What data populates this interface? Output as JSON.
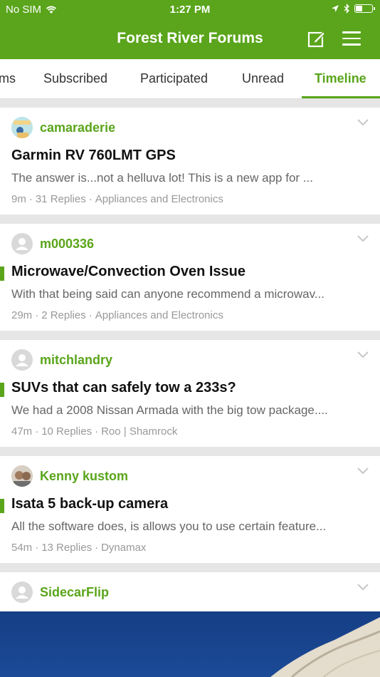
{
  "status_bar": {
    "carrier": "No SIM",
    "time": "1:27 PM"
  },
  "header": {
    "title": "Forest River Forums",
    "compose_icon": "compose-icon",
    "menu_icon": "hamburger-menu-icon",
    "bg_color": "#5aa51b"
  },
  "tabs": [
    {
      "label": "ms",
      "active": false
    },
    {
      "label": "Subscribed",
      "active": false
    },
    {
      "label": "Participated",
      "active": false
    },
    {
      "label": "Unread",
      "active": false
    },
    {
      "label": "Timeline",
      "active": true
    }
  ],
  "topics": [
    {
      "author": "camaraderie",
      "title": "Garmin RV 760LMT GPS",
      "excerpt": "The answer is...not a helluva lot! This is a new app for ...",
      "time": "9m",
      "replies": "31 Replies",
      "forum": "Appliances and Electronics",
      "unread": false
    },
    {
      "author": "m000336",
      "title": "Microwave/Convection Oven Issue",
      "excerpt": "With that being said can anyone recommend a microwav...",
      "time": "29m",
      "replies": "2 Replies",
      "forum": "Appliances and Electronics",
      "unread": true
    },
    {
      "author": "mitchlandry",
      "title": "SUVs that can safely tow a 233s?",
      "excerpt": "We had a 2008 Nissan Armada with the big tow package....",
      "time": "47m",
      "replies": "10 Replies",
      "forum": "Roo | Shamrock",
      "unread": true
    },
    {
      "author": "Kenny kustom",
      "title": "Isata 5 back-up camera",
      "excerpt": "All the software does, is allows you to use certain feature...",
      "time": "54m",
      "replies": "13 Replies",
      "forum": "Dynamax",
      "unread": true
    },
    {
      "author": "SidecarFlip"
    }
  ],
  "meta_separator": "·"
}
